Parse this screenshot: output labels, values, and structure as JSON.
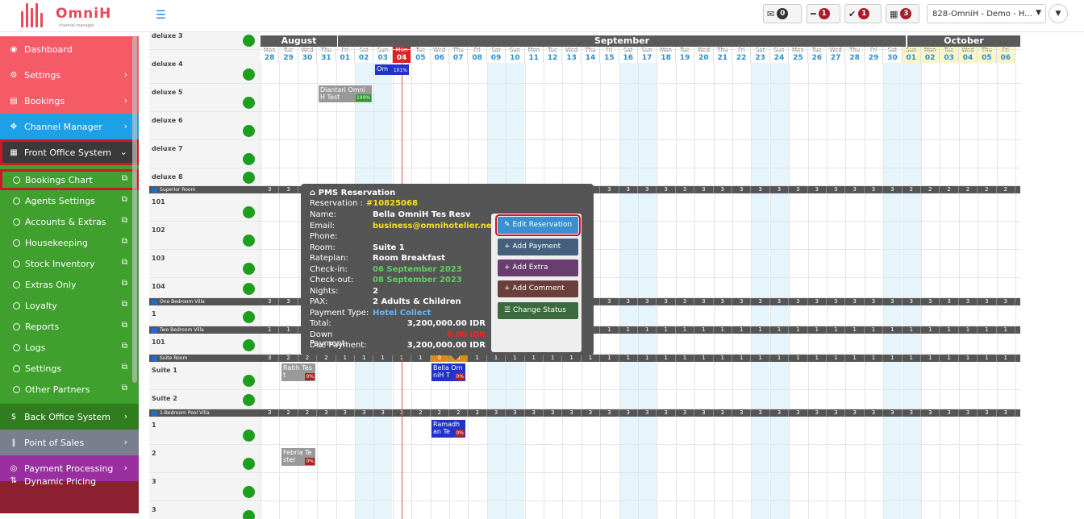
{
  "brand": {
    "name": "OmniH",
    "sub": "channel manager"
  },
  "topbar": {
    "mail_count": "0",
    "minus_count": "1",
    "check_count": "1",
    "cal_count": "3",
    "property": "828-OmniH - Demo - H..."
  },
  "sidebar": {
    "items": [
      {
        "label": "Dashboard",
        "icon": "dashboard-icon"
      },
      {
        "label": "Settings",
        "icon": "gear-icon"
      },
      {
        "label": "Bookings",
        "icon": "bookings-icon"
      },
      {
        "label": "Channel Manager",
        "icon": "arrows-icon"
      },
      {
        "label": "Front Office System",
        "icon": "calendar-icon"
      }
    ],
    "sub": [
      "Bookings Chart",
      "Agents Settings",
      "Accounts & Extras",
      "Housekeeping",
      "Stock Inventory",
      "Extras Only",
      "Loyalty",
      "Reports",
      "Logs",
      "Settings",
      "Other Partners"
    ],
    "after": [
      {
        "label": "Back Office System",
        "icon": "dollar-icon"
      },
      {
        "label": "Point of Sales",
        "icon": "cutlery-icon"
      },
      {
        "label": "Payment Processing",
        "icon": "payment-icon"
      },
      {
        "label": "Dynamic Pricing",
        "icon": "pricing-icon"
      }
    ]
  },
  "chart": {
    "months": [
      "August",
      "September",
      "October"
    ],
    "days": [
      [
        "Mon",
        "28"
      ],
      [
        "Tue",
        "29"
      ],
      [
        "Wed",
        "30"
      ],
      [
        "Thu",
        "31"
      ],
      [
        "Fri",
        "01"
      ],
      [
        "Sat",
        "02"
      ],
      [
        "Sun",
        "03"
      ],
      [
        "Mon",
        "04"
      ],
      [
        "Tue",
        "05"
      ],
      [
        "Wed",
        "06"
      ],
      [
        "Thu",
        "07"
      ],
      [
        "Fri",
        "08"
      ],
      [
        "Sat",
        "09"
      ],
      [
        "Sun",
        "10"
      ],
      [
        "Mon",
        "11"
      ],
      [
        "Tue",
        "12"
      ],
      [
        "Wed",
        "13"
      ],
      [
        "Thu",
        "14"
      ],
      [
        "Fri",
        "15"
      ],
      [
        "Sat",
        "16"
      ],
      [
        "Sun",
        "17"
      ],
      [
        "Mon",
        "18"
      ],
      [
        "Tue",
        "19"
      ],
      [
        "Wed",
        "20"
      ],
      [
        "Thu",
        "21"
      ],
      [
        "Fri",
        "22"
      ],
      [
        "Sat",
        "23"
      ],
      [
        "Sun",
        "24"
      ],
      [
        "Mon",
        "25"
      ],
      [
        "Tue",
        "26"
      ],
      [
        "Wed",
        "27"
      ],
      [
        "Thu",
        "28"
      ],
      [
        "Fri",
        "29"
      ],
      [
        "Sat",
        "30"
      ],
      [
        "Sun",
        "01"
      ],
      [
        "Mon",
        "02"
      ],
      [
        "Tue",
        "03"
      ],
      [
        "Wed",
        "04"
      ],
      [
        "Thu",
        "05"
      ],
      [
        "Fri",
        "06"
      ]
    ],
    "rooms": [
      "deluxe 3",
      "deluxe 4",
      "deluxe 5",
      "deluxe 6",
      "deluxe 7",
      "deluxe 8",
      "101",
      "102",
      "103",
      "104",
      "1",
      "101",
      "Suite 1",
      "Suite 2",
      "1",
      "2",
      "3",
      "3"
    ],
    "groups": [
      "Superior Room",
      "One Bedroom Villa",
      "Two Bedroom Villa",
      "Suite Room",
      "1-Bedroom Pool Villa"
    ],
    "group_counts": {
      "superior": [
        "3",
        "3",
        "3",
        "3",
        "3",
        "3",
        "3",
        "3",
        "3",
        "3",
        "3",
        "3",
        "3",
        "3",
        "3",
        "3",
        "3",
        "3",
        "3",
        "3",
        "3",
        "3",
        "3",
        "3",
        "3",
        "3",
        "3",
        "3",
        "3",
        "3",
        "3",
        "3",
        "3",
        "3",
        "2",
        "2",
        "2",
        "2",
        "2",
        "2"
      ],
      "onebed": [
        "3",
        "3",
        "3",
        "3",
        "3",
        "3",
        "3",
        "3",
        "3",
        "3",
        "3",
        "3",
        "3",
        "3",
        "3",
        "3",
        "3",
        "3",
        "3",
        "3",
        "3",
        "3",
        "3",
        "3",
        "3",
        "3",
        "3",
        "3",
        "3",
        "3",
        "3",
        "3",
        "3",
        "3",
        "3",
        "3",
        "3",
        "3",
        "3",
        "3"
      ],
      "twobed": [
        "1",
        "1",
        "1",
        "1",
        "1",
        "1",
        "1",
        "1",
        "1",
        "1",
        "1",
        "1",
        "1",
        "1",
        "1",
        "1",
        "1",
        "1",
        "1",
        "1",
        "1",
        "1",
        "1",
        "1",
        "1",
        "1",
        "1",
        "1",
        "1",
        "1",
        "1",
        "1",
        "1",
        "1",
        "1",
        "1",
        "1",
        "1",
        "1",
        "1"
      ],
      "suite": [
        "3",
        "2",
        "2",
        "2",
        "1",
        "1",
        "1",
        "1",
        "1",
        "0",
        "0",
        "1",
        "1",
        "1",
        "1",
        "1",
        "1",
        "1",
        "1",
        "1",
        "1",
        "1",
        "1",
        "1",
        "1",
        "1",
        "1",
        "1",
        "1",
        "1",
        "1",
        "1",
        "1",
        "1",
        "1",
        "1",
        "1",
        "1",
        "1",
        "1"
      ],
      "pool": [
        "3",
        "2",
        "2",
        "3",
        "3",
        "3",
        "3",
        "3",
        "2",
        "2",
        "2",
        "3",
        "3",
        "3",
        "3",
        "3",
        "3",
        "3",
        "3",
        "3",
        "3",
        "3",
        "3",
        "3",
        "3",
        "3",
        "3",
        "3",
        "3",
        "3",
        "3",
        "3",
        "3",
        "3",
        "3",
        "3",
        "3",
        "3",
        "3",
        "3"
      ]
    },
    "bookings": [
      {
        "name": "Om",
        "pct": "101%"
      },
      {
        "name": "Diantari Omni H Test",
        "pct": "100%"
      },
      {
        "name": "Ratih Tes t",
        "pct": "0%"
      },
      {
        "name": "Bella Om niH T",
        "pct": "0%"
      },
      {
        "name": "Ramadh an Te",
        "pct": "0%"
      },
      {
        "name": "Febria Te ster",
        "pct": "0%"
      }
    ]
  },
  "popup": {
    "title": "PMS Reservation",
    "reservation_label": "Reservation :",
    "reservation_no": "#10825068",
    "rows": [
      {
        "k": "Name:",
        "v": "Bella OmniH Tes Resv"
      },
      {
        "k": "Email:",
        "v": "business@omnihotelier.net"
      },
      {
        "k": "Phone:",
        "v": ""
      },
      {
        "k": "Room:",
        "v": "Suite 1"
      },
      {
        "k": "Rateplan:",
        "v": "Room Breakfast"
      },
      {
        "k": "Check-in:",
        "v": "06 September 2023"
      },
      {
        "k": "Check-out:",
        "v": "08 September 2023"
      },
      {
        "k": "Nights:",
        "v": "2"
      },
      {
        "k": "PAX:",
        "v": "2 Adults & Children"
      },
      {
        "k": "Payment Type:",
        "v": "Hotel Collect"
      },
      {
        "k": "Total:",
        "v": "3,200,000.00 IDR"
      },
      {
        "k": "Down Payment:",
        "v": "0.00 IDR"
      },
      {
        "k": "Due Payment:",
        "v": "3,200,000.00 IDR"
      }
    ],
    "actions": [
      "Edit Reservation",
      "Add Payment",
      "Add Extra",
      "Add Comment",
      "Change Status"
    ]
  },
  "colors": {
    "accent": "#f45b67",
    "today": "#e02020",
    "booking_blue": "#2233cc",
    "popup_bg": "#555555"
  }
}
